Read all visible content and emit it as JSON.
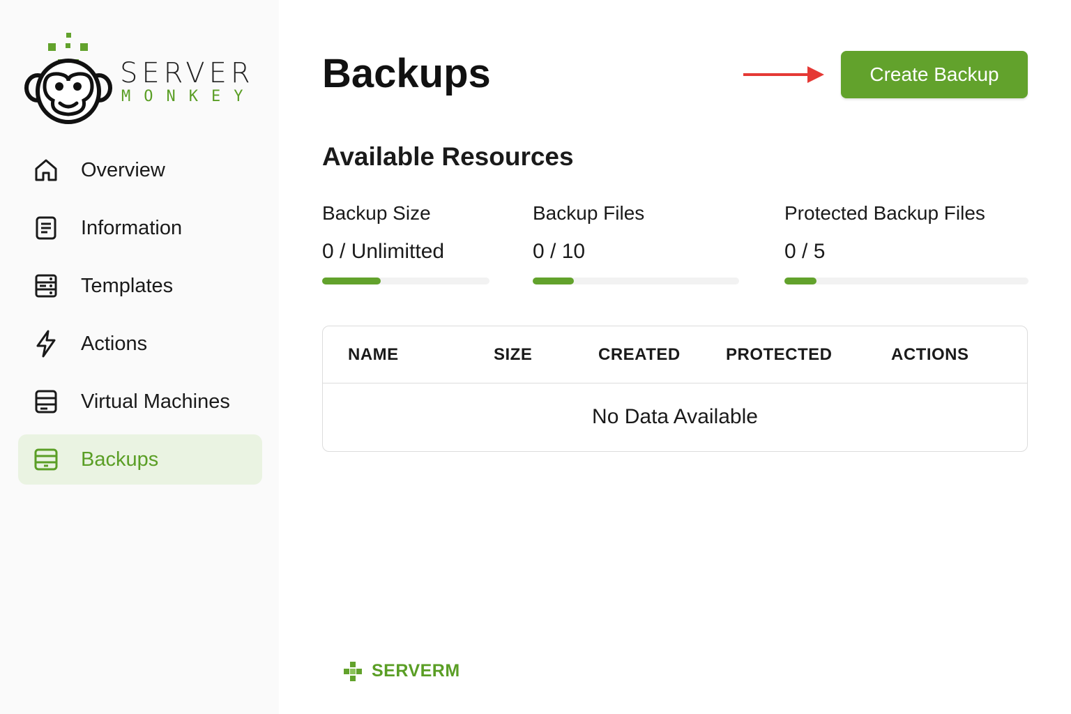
{
  "brand": {
    "line1": "SERVER",
    "line2": "MONKEY",
    "footer": "SERVERM",
    "accent_color": "#62a22c",
    "text_color": "#222222"
  },
  "sidebar": {
    "items": [
      {
        "label": "Overview",
        "icon": "home-icon",
        "active": false
      },
      {
        "label": "Information",
        "icon": "document-icon",
        "active": false
      },
      {
        "label": "Templates",
        "icon": "server-rack-icon",
        "active": false
      },
      {
        "label": "Actions",
        "icon": "lightning-icon",
        "active": false
      },
      {
        "label": "Virtual Machines",
        "icon": "list-box-icon",
        "active": false
      },
      {
        "label": "Backups",
        "icon": "backup-drive-icon",
        "active": true
      }
    ]
  },
  "header": {
    "title": "Backups",
    "create_button": "Create Backup",
    "arrow_color": "#e53935"
  },
  "resources": {
    "title": "Available Resources",
    "items": [
      {
        "label": "Backup Size",
        "value": "0 / Unlimitted",
        "fill": 0.35
      },
      {
        "label": "Backup Files",
        "value": "0 / 10",
        "fill": 0.2
      },
      {
        "label": "Protected Backup Files",
        "value": "0 / 5",
        "fill": 0.13
      }
    ]
  },
  "table": {
    "columns": [
      "NAME",
      "SIZE",
      "CREATED",
      "PROTECTED",
      "ACTIONS"
    ],
    "empty_text": "No Data Available"
  }
}
